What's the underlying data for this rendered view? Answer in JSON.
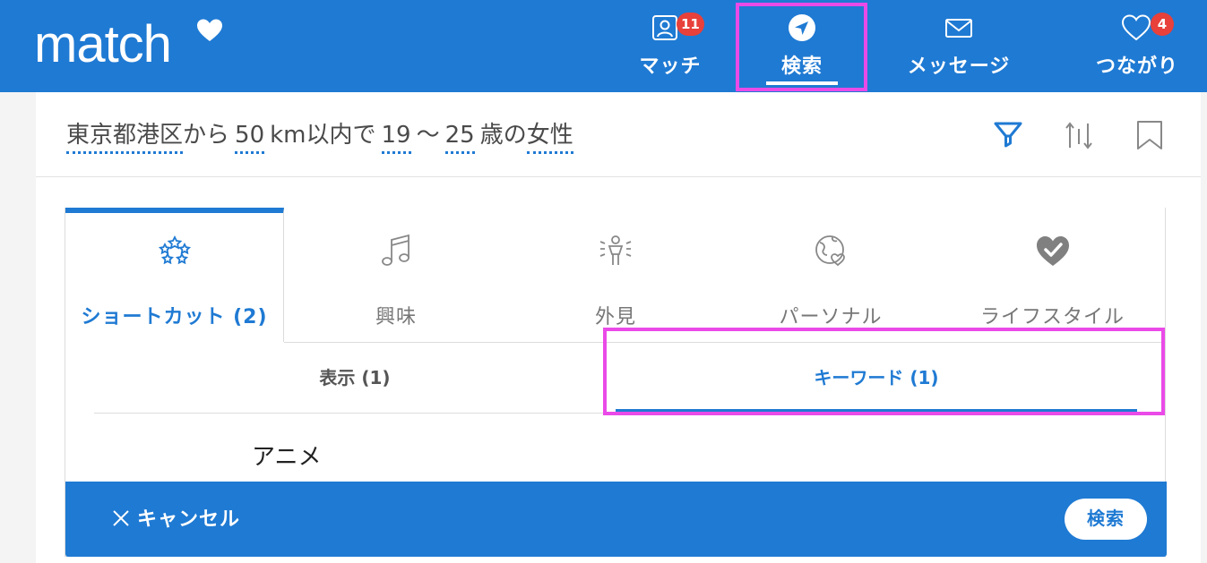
{
  "app": {
    "logo_text": "match"
  },
  "nav": {
    "items": [
      {
        "label": "マッチ",
        "badge": "11",
        "icon": "profile-card-icon"
      },
      {
        "label": "検索",
        "badge": "",
        "icon": "compass-arrow-icon",
        "active": true
      },
      {
        "label": "メッセージ",
        "badge": "",
        "icon": "envelope-icon"
      },
      {
        "label": "つながり",
        "badge": "4",
        "icon": "heart-outline-icon"
      }
    ]
  },
  "summary": {
    "location": "東京都港区",
    "t_from": "から",
    "distance": "50",
    "t_unit": "km以内で",
    "age_min": "19",
    "t_tilde": "〜",
    "age_max": "25",
    "t_age": "歳の",
    "gender": "女性",
    "tools": [
      "filter-icon",
      "sort-icon",
      "bookmark-icon"
    ]
  },
  "categories": [
    {
      "label": "ショートカット (2)",
      "icon": "stars-icon",
      "active": true
    },
    {
      "label": "興味",
      "icon": "music-note-icon"
    },
    {
      "label": "外見",
      "icon": "person-spotlight-icon"
    },
    {
      "label": "パーソナル",
      "icon": "globe-heart-icon"
    },
    {
      "label": "ライフスタイル",
      "icon": "heart-check-icon"
    }
  ],
  "subtabs": [
    {
      "label": "表示 (1)"
    },
    {
      "label": "キーワード (1)",
      "active": true
    }
  ],
  "keyword": "アニメ",
  "actions": {
    "cancel": "キャンセル",
    "search": "検索"
  },
  "colors": {
    "brand": "#1f7ad3",
    "badge": "#e8403a",
    "annotation": "#ea4ae8"
  }
}
